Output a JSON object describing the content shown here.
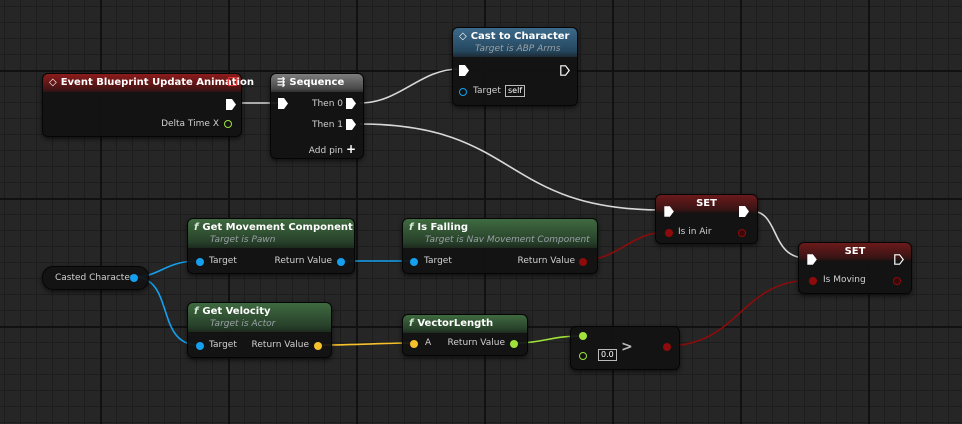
{
  "nodes": {
    "event": {
      "title": "Event Blueprint Update Animation",
      "pin_delta": "Delta Time X"
    },
    "sequence": {
      "title": "Sequence",
      "then0": "Then 0",
      "then1": "Then 1",
      "add_pin": "Add pin"
    },
    "cast": {
      "title": "Cast to Character",
      "subtitle": "Target is ABP Arms",
      "target": "Target",
      "self": "self"
    },
    "casted": {
      "label": "Casted Character"
    },
    "get_movement": {
      "title": "Get Movement Component",
      "subtitle": "Target is Pawn",
      "target": "Target",
      "ret": "Return Value"
    },
    "is_falling": {
      "title": "Is Falling",
      "subtitle": "Target is Nav Movement Component",
      "target": "Target",
      "ret": "Return Value"
    },
    "get_velocity": {
      "title": "Get Velocity",
      "subtitle": "Target is Actor",
      "target": "Target",
      "ret": "Return Value"
    },
    "vector_length": {
      "title": "VectorLength",
      "a": "A",
      "ret": "Return Value"
    },
    "greater": {
      "value": "0.0",
      "op": ">"
    },
    "set1": {
      "title": "SET",
      "var": "Is in Air"
    },
    "set2": {
      "title": "SET",
      "var": "Is Moving"
    }
  },
  "colors": {
    "exec": "#ffffff",
    "object": "#14a0ee",
    "bool": "#8e0b0b",
    "vector": "#f6c12b",
    "float": "#9ee23a",
    "background": "#262626"
  }
}
